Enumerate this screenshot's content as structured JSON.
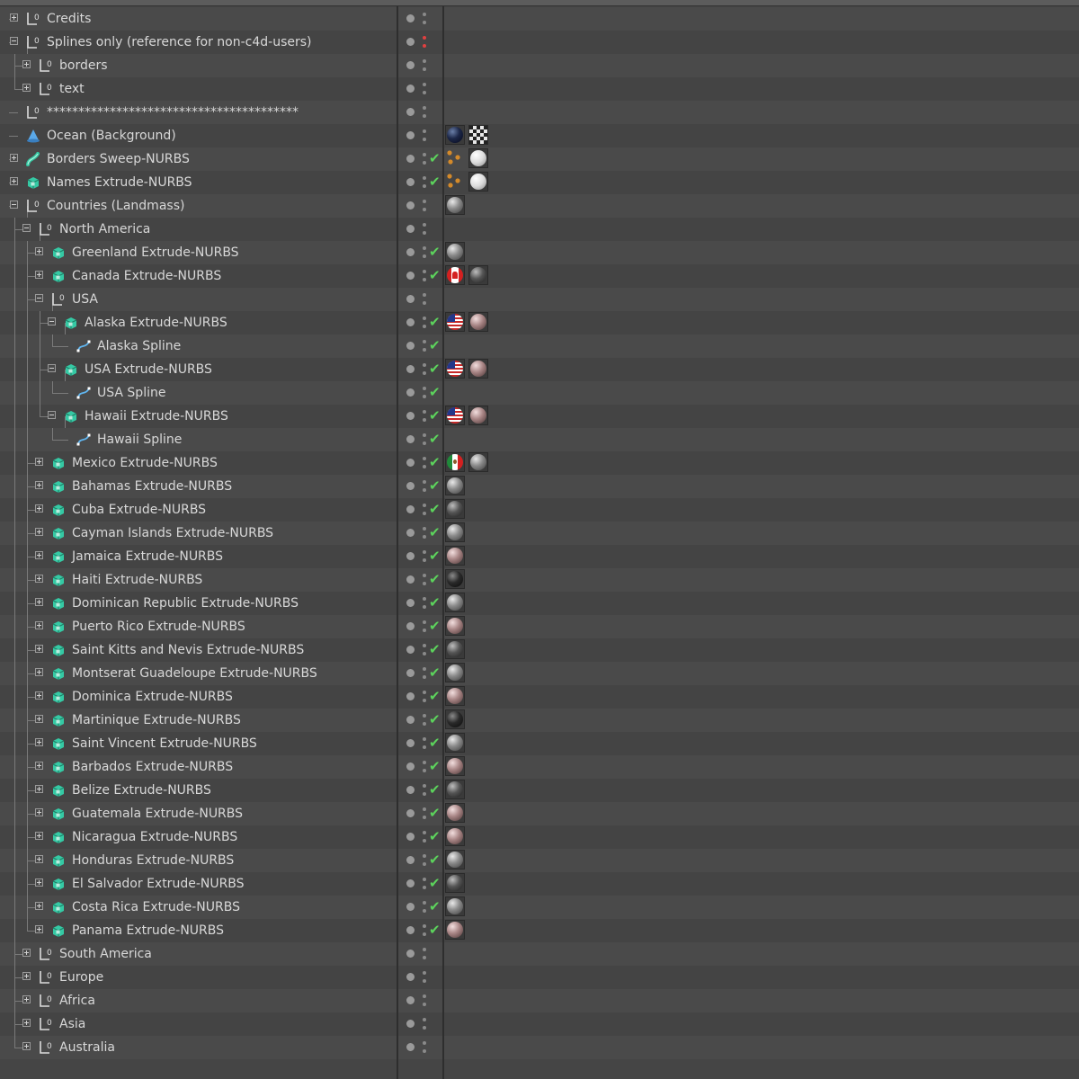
{
  "window": {
    "panel_bg": "#454545"
  },
  "colors": {
    "check": "#5cd35c",
    "red_dot": "#e04040",
    "label": "#d8d8d8"
  },
  "rows": [
    {
      "label": "Credits",
      "indent": 0,
      "expander": "plus",
      "icon": "null-icon",
      "tags": []
    },
    {
      "label": "Splines only (reference for non-c4d-users)",
      "indent": 0,
      "expander": "minus",
      "icon": "null-icon",
      "red_dot": true,
      "tags": []
    },
    {
      "label": "borders",
      "indent": 1,
      "expander": "plus",
      "icon": "null-icon",
      "tags": []
    },
    {
      "label": "text",
      "indent": 1,
      "expander": "plus",
      "icon": "null-icon",
      "tags": []
    },
    {
      "label": "****************************************",
      "indent": 0,
      "expander": "none",
      "icon": "null-icon",
      "tags": []
    },
    {
      "label": "Ocean (Background)",
      "indent": 0,
      "expander": "none",
      "icon": "background-icon",
      "tags": [
        "navy-material",
        "checker-material"
      ]
    },
    {
      "label": "Borders Sweep-NURBS",
      "indent": 0,
      "expander": "plus",
      "icon": "sweep-icon",
      "check": true,
      "tags": [
        "tag-icon",
        "white-material"
      ]
    },
    {
      "label": "Names Extrude-NURBS",
      "indent": 0,
      "expander": "plus",
      "icon": "extrude-icon",
      "check": true,
      "tags": [
        "tag-icon",
        "white-material"
      ]
    },
    {
      "label": "Countries (Landmass)",
      "indent": 0,
      "expander": "minus",
      "icon": "null-icon",
      "tags": [
        "gray-material"
      ]
    },
    {
      "label": "North America",
      "indent": 1,
      "expander": "minus",
      "icon": "null-icon",
      "tags": []
    },
    {
      "label": "Greenland Extrude-NURBS",
      "indent": 2,
      "expander": "plus",
      "icon": "extrude-icon",
      "check": true,
      "tags": [
        "gray-material"
      ]
    },
    {
      "label": "Canada Extrude-NURBS",
      "indent": 2,
      "expander": "plus",
      "icon": "extrude-icon",
      "check": true,
      "tags": [
        "canada-flag-material",
        "dark-material"
      ]
    },
    {
      "label": "USA",
      "indent": 2,
      "expander": "minus",
      "icon": "null-icon",
      "tags": []
    },
    {
      "label": "Alaska Extrude-NURBS",
      "indent": 3,
      "expander": "minus",
      "icon": "extrude-icon",
      "check": true,
      "tags": [
        "usa-flag-material",
        "pink-material"
      ]
    },
    {
      "label": "Alaska Spline",
      "indent": 4,
      "expander": "leaf",
      "icon": "spline-icon",
      "check": true,
      "tags": []
    },
    {
      "label": "USA Extrude-NURBS",
      "indent": 3,
      "expander": "minus",
      "icon": "extrude-icon",
      "check": true,
      "tags": [
        "usa-flag-material",
        "pink-material"
      ]
    },
    {
      "label": "USA Spline",
      "indent": 4,
      "expander": "leaf",
      "icon": "spline-icon",
      "check": true,
      "tags": []
    },
    {
      "label": "Hawaii Extrude-NURBS",
      "indent": 3,
      "expander": "minus",
      "icon": "extrude-icon",
      "check": true,
      "tags": [
        "usa-flag-material",
        "pink-material"
      ]
    },
    {
      "label": "Hawaii Spline",
      "indent": 4,
      "expander": "leaf",
      "icon": "spline-icon",
      "check": true,
      "tags": []
    },
    {
      "label": "Mexico Extrude-NURBS",
      "indent": 2,
      "expander": "plus",
      "icon": "extrude-icon",
      "check": true,
      "tags": [
        "mexico-flag-material",
        "gray-material"
      ]
    },
    {
      "label": "Bahamas Extrude-NURBS",
      "indent": 2,
      "expander": "plus",
      "icon": "extrude-icon",
      "check": true,
      "tags": [
        "gray-material"
      ]
    },
    {
      "label": "Cuba Extrude-NURBS",
      "indent": 2,
      "expander": "plus",
      "icon": "extrude-icon",
      "check": true,
      "tags": [
        "dark-material"
      ]
    },
    {
      "label": "Cayman Islands Extrude-NURBS",
      "indent": 2,
      "expander": "plus",
      "icon": "extrude-icon",
      "check": true,
      "tags": [
        "gray-material"
      ]
    },
    {
      "label": "Jamaica Extrude-NURBS",
      "indent": 2,
      "expander": "plus",
      "icon": "extrude-icon",
      "check": true,
      "tags": [
        "pink-material"
      ]
    },
    {
      "label": "Haiti Extrude-NURBS",
      "indent": 2,
      "expander": "plus",
      "icon": "extrude-icon",
      "check": true,
      "tags": [
        "black-material"
      ]
    },
    {
      "label": "Dominican Republic Extrude-NURBS",
      "indent": 2,
      "expander": "plus",
      "icon": "extrude-icon",
      "check": true,
      "tags": [
        "gray-material"
      ]
    },
    {
      "label": "Puerto Rico Extrude-NURBS",
      "indent": 2,
      "expander": "plus",
      "icon": "extrude-icon",
      "check": true,
      "tags": [
        "pink-material"
      ]
    },
    {
      "label": "Saint Kitts and Nevis Extrude-NURBS",
      "indent": 2,
      "expander": "plus",
      "icon": "extrude-icon",
      "check": true,
      "tags": [
        "dark-material"
      ]
    },
    {
      "label": "Montserat Guadeloupe Extrude-NURBS",
      "indent": 2,
      "expander": "plus",
      "icon": "extrude-icon",
      "check": true,
      "tags": [
        "gray-material"
      ]
    },
    {
      "label": "Dominica Extrude-NURBS",
      "indent": 2,
      "expander": "plus",
      "icon": "extrude-icon",
      "check": true,
      "tags": [
        "pink-material"
      ]
    },
    {
      "label": "Martinique Extrude-NURBS",
      "indent": 2,
      "expander": "plus",
      "icon": "extrude-icon",
      "check": true,
      "tags": [
        "black-material"
      ]
    },
    {
      "label": "Saint Vincent Extrude-NURBS",
      "indent": 2,
      "expander": "plus",
      "icon": "extrude-icon",
      "check": true,
      "tags": [
        "gray-material"
      ]
    },
    {
      "label": "Barbados Extrude-NURBS",
      "indent": 2,
      "expander": "plus",
      "icon": "extrude-icon",
      "check": true,
      "tags": [
        "pink-material"
      ]
    },
    {
      "label": "Belize Extrude-NURBS",
      "indent": 2,
      "expander": "plus",
      "icon": "extrude-icon",
      "check": true,
      "tags": [
        "dark-material"
      ]
    },
    {
      "label": "Guatemala Extrude-NURBS",
      "indent": 2,
      "expander": "plus",
      "icon": "extrude-icon",
      "check": true,
      "tags": [
        "pink-material"
      ]
    },
    {
      "label": "Nicaragua Extrude-NURBS",
      "indent": 2,
      "expander": "plus",
      "icon": "extrude-icon",
      "check": true,
      "tags": [
        "pink-material"
      ]
    },
    {
      "label": "Honduras Extrude-NURBS",
      "indent": 2,
      "expander": "plus",
      "icon": "extrude-icon",
      "check": true,
      "tags": [
        "gray-material"
      ]
    },
    {
      "label": "El Salvador Extrude-NURBS",
      "indent": 2,
      "expander": "plus",
      "icon": "extrude-icon",
      "check": true,
      "tags": [
        "dark-material"
      ]
    },
    {
      "label": "Costa Rica Extrude-NURBS",
      "indent": 2,
      "expander": "plus",
      "icon": "extrude-icon",
      "check": true,
      "tags": [
        "gray-material"
      ]
    },
    {
      "label": "Panama Extrude-NURBS",
      "indent": 2,
      "expander": "plus",
      "icon": "extrude-icon",
      "check": true,
      "tags": [
        "pink-material"
      ]
    },
    {
      "label": "South America",
      "indent": 1,
      "expander": "plus",
      "icon": "null-icon",
      "tags": []
    },
    {
      "label": "Europe",
      "indent": 1,
      "expander": "plus",
      "icon": "null-icon",
      "tags": []
    },
    {
      "label": "Africa",
      "indent": 1,
      "expander": "plus",
      "icon": "null-icon",
      "tags": []
    },
    {
      "label": "Asia",
      "indent": 1,
      "expander": "plus",
      "icon": "null-icon",
      "tags": []
    },
    {
      "label": "Australia",
      "indent": 1,
      "expander": "plus",
      "icon": "null-icon",
      "tags": []
    }
  ]
}
